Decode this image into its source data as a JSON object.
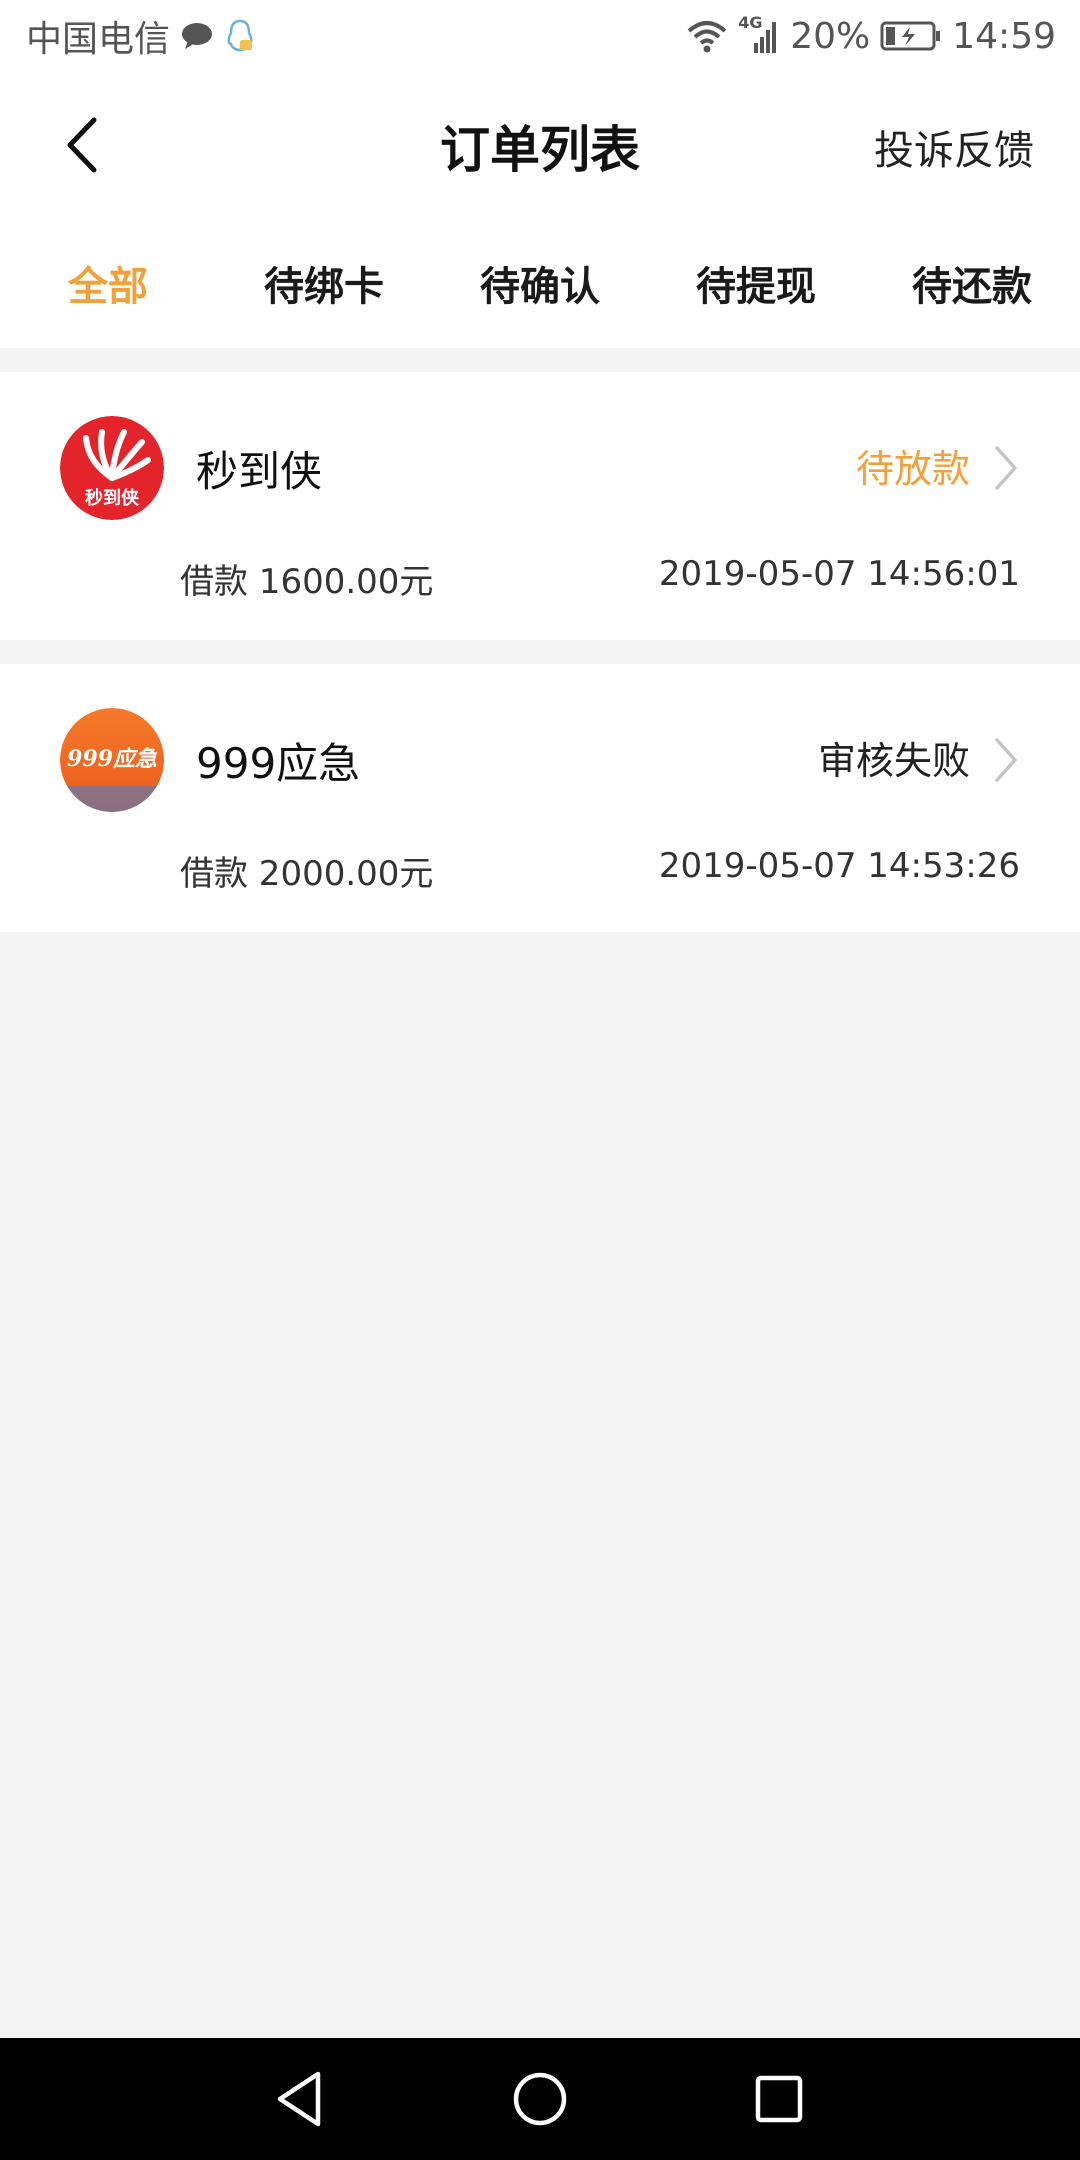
{
  "status_bar": {
    "carrier": "中国电信",
    "network": "4G",
    "battery": "20%",
    "time": "14:59",
    "icons": [
      "chat-bubble-icon",
      "qq-icon",
      "wifi-icon",
      "signal-icon",
      "battery-charging-icon"
    ]
  },
  "header": {
    "title": "订单列表",
    "complaint_label": "投诉反馈"
  },
  "tabs": [
    {
      "label": "全部",
      "active": true
    },
    {
      "label": "待绑卡",
      "active": false
    },
    {
      "label": "待确认",
      "active": false
    },
    {
      "label": "待提现",
      "active": false
    },
    {
      "label": "待还款",
      "active": false
    }
  ],
  "orders": [
    {
      "name": "秒到侠",
      "logo_text": "秒到侠",
      "status": "待放款",
      "status_color": "#f2a13a",
      "amount": "借款 1600.00元",
      "time": "2019-05-07 14:56:01"
    },
    {
      "name": "999应急",
      "logo_text": "999应急",
      "status": "审核失败",
      "status_color": "#222222",
      "amount": "借款 2000.00元",
      "time": "2019-05-07 14:53:26"
    }
  ],
  "colors": {
    "accent": "#f2a13a",
    "background": "#f3f3f3"
  },
  "nav": [
    "back-icon",
    "home-icon",
    "recents-icon"
  ]
}
